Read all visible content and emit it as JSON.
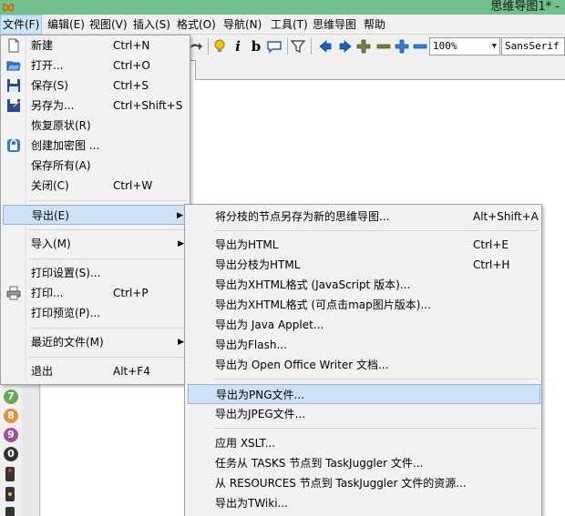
{
  "window": {
    "title": "思维导图1* -"
  },
  "menubar": [
    {
      "label": "文件(F)",
      "active": true
    },
    {
      "label": "编辑(E)"
    },
    {
      "label": "视图(V)"
    },
    {
      "label": "插入(S)"
    },
    {
      "label": "格式(O)"
    },
    {
      "label": "导航(N)"
    },
    {
      "label": "工具(T)"
    },
    {
      "label": "思维导图"
    },
    {
      "label": "帮助"
    }
  ],
  "toolbar": {
    "zoom_value": "100%",
    "font_value": "SansSerif"
  },
  "file_menu": {
    "items": [
      {
        "label": "新建",
        "shortcut": "Ctrl+N",
        "icon": "new-file-icon"
      },
      {
        "label": "打开...",
        "shortcut": "Ctrl+O",
        "icon": "open-folder-icon"
      },
      {
        "label": "保存(S)",
        "shortcut": "Ctrl+S",
        "icon": "save-disk-icon"
      },
      {
        "label": "另存为...",
        "shortcut": "Ctrl+Shift+S",
        "icon": "save-as-icon"
      },
      {
        "label": "恢复原状(R)",
        "shortcut": ""
      },
      {
        "label": "创建加密图 ...",
        "shortcut": "",
        "icon": "lock-icon"
      },
      {
        "label": "保存所有(A)",
        "shortcut": ""
      },
      {
        "label": "关闭(C)",
        "shortcut": "Ctrl+W"
      },
      {
        "label": "导出(E)",
        "shortcut": "",
        "submenu": true,
        "highlighted": true
      },
      {
        "label": "导入(M)",
        "shortcut": "",
        "submenu": true
      },
      {
        "label": "打印设置(S)...",
        "shortcut": ""
      },
      {
        "label": "打印...",
        "shortcut": "Ctrl+P",
        "icon": "printer-icon"
      },
      {
        "label": "打印预览(P)...",
        "shortcut": ""
      },
      {
        "label": "最近的文件(M)",
        "shortcut": "",
        "submenu": true
      },
      {
        "label": "退出",
        "shortcut": "Alt+F4"
      }
    ]
  },
  "export_menu": {
    "items": [
      {
        "label": "将分枝的节点另存为新的思维导图...",
        "shortcut": "Alt+Shift+A"
      },
      {
        "label": "导出为HTML",
        "shortcut": "Ctrl+E"
      },
      {
        "label": "导出分枝为HTML",
        "shortcut": "Ctrl+H"
      },
      {
        "label": "导出为XHTML格式 (JavaScript 版本)...",
        "shortcut": ""
      },
      {
        "label": "导出为XHTML格式 (可点击map图片版本)...",
        "shortcut": ""
      },
      {
        "label": "导出为 Java Applet...",
        "shortcut": ""
      },
      {
        "label": "导出为Flash...",
        "shortcut": ""
      },
      {
        "label": "导出为 Open Office Writer 文档...",
        "shortcut": ""
      },
      {
        "label": "导出为PNG文件...",
        "shortcut": "",
        "highlighted": true
      },
      {
        "label": "导出为JPEG文件...",
        "shortcut": ""
      },
      {
        "label": "应用 XSLT...",
        "shortcut": ""
      },
      {
        "label": "任务从 TASKS 节点到 TaskJuggler 文件...",
        "shortcut": ""
      },
      {
        "label": "从 RESOURCES 节点到 TaskJuggler 文件的资源...",
        "shortcut": ""
      },
      {
        "label": "导出为TWiki...",
        "shortcut": ""
      }
    ]
  },
  "left_icons": {
    "numbers": [
      "7",
      "8",
      "9",
      "0"
    ],
    "colors": {
      "seven": "#6aa84f",
      "eight": "#e69138",
      "nine": "#a64d9a",
      "zero": "#333333"
    }
  },
  "colors": {
    "titlebar": "#6fc08a",
    "highlight": "#cde2f6",
    "menubar_active": "#cce4f7"
  }
}
